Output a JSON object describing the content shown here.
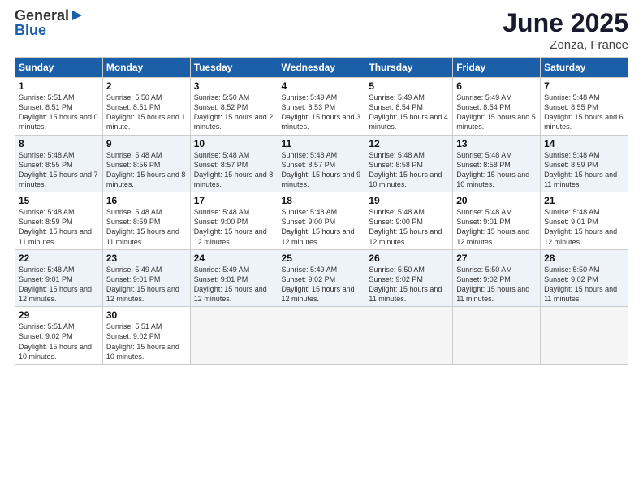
{
  "logo": {
    "text_general": "General",
    "text_blue": "Blue"
  },
  "title": "June 2025",
  "subtitle": "Zonza, France",
  "days_of_week": [
    "Sunday",
    "Monday",
    "Tuesday",
    "Wednesday",
    "Thursday",
    "Friday",
    "Saturday"
  ],
  "weeks": [
    [
      {
        "day": "1",
        "sunrise": "5:51 AM",
        "sunset": "8:51 PM",
        "daylight": "15 hours and 0 minutes."
      },
      {
        "day": "2",
        "sunrise": "5:50 AM",
        "sunset": "8:51 PM",
        "daylight": "15 hours and 1 minute."
      },
      {
        "day": "3",
        "sunrise": "5:50 AM",
        "sunset": "8:52 PM",
        "daylight": "15 hours and 2 minutes."
      },
      {
        "day": "4",
        "sunrise": "5:49 AM",
        "sunset": "8:53 PM",
        "daylight": "15 hours and 3 minutes."
      },
      {
        "day": "5",
        "sunrise": "5:49 AM",
        "sunset": "8:54 PM",
        "daylight": "15 hours and 4 minutes."
      },
      {
        "day": "6",
        "sunrise": "5:49 AM",
        "sunset": "8:54 PM",
        "daylight": "15 hours and 5 minutes."
      },
      {
        "day": "7",
        "sunrise": "5:48 AM",
        "sunset": "8:55 PM",
        "daylight": "15 hours and 6 minutes."
      }
    ],
    [
      {
        "day": "8",
        "sunrise": "5:48 AM",
        "sunset": "8:55 PM",
        "daylight": "15 hours and 7 minutes."
      },
      {
        "day": "9",
        "sunrise": "5:48 AM",
        "sunset": "8:56 PM",
        "daylight": "15 hours and 8 minutes."
      },
      {
        "day": "10",
        "sunrise": "5:48 AM",
        "sunset": "8:57 PM",
        "daylight": "15 hours and 8 minutes."
      },
      {
        "day": "11",
        "sunrise": "5:48 AM",
        "sunset": "8:57 PM",
        "daylight": "15 hours and 9 minutes."
      },
      {
        "day": "12",
        "sunrise": "5:48 AM",
        "sunset": "8:58 PM",
        "daylight": "15 hours and 10 minutes."
      },
      {
        "day": "13",
        "sunrise": "5:48 AM",
        "sunset": "8:58 PM",
        "daylight": "15 hours and 10 minutes."
      },
      {
        "day": "14",
        "sunrise": "5:48 AM",
        "sunset": "8:59 PM",
        "daylight": "15 hours and 11 minutes."
      }
    ],
    [
      {
        "day": "15",
        "sunrise": "5:48 AM",
        "sunset": "8:59 PM",
        "daylight": "15 hours and 11 minutes."
      },
      {
        "day": "16",
        "sunrise": "5:48 AM",
        "sunset": "8:59 PM",
        "daylight": "15 hours and 11 minutes."
      },
      {
        "day": "17",
        "sunrise": "5:48 AM",
        "sunset": "9:00 PM",
        "daylight": "15 hours and 12 minutes."
      },
      {
        "day": "18",
        "sunrise": "5:48 AM",
        "sunset": "9:00 PM",
        "daylight": "15 hours and 12 minutes."
      },
      {
        "day": "19",
        "sunrise": "5:48 AM",
        "sunset": "9:00 PM",
        "daylight": "15 hours and 12 minutes."
      },
      {
        "day": "20",
        "sunrise": "5:48 AM",
        "sunset": "9:01 PM",
        "daylight": "15 hours and 12 minutes."
      },
      {
        "day": "21",
        "sunrise": "5:48 AM",
        "sunset": "9:01 PM",
        "daylight": "15 hours and 12 minutes."
      }
    ],
    [
      {
        "day": "22",
        "sunrise": "5:48 AM",
        "sunset": "9:01 PM",
        "daylight": "15 hours and 12 minutes."
      },
      {
        "day": "23",
        "sunrise": "5:49 AM",
        "sunset": "9:01 PM",
        "daylight": "15 hours and 12 minutes."
      },
      {
        "day": "24",
        "sunrise": "5:49 AM",
        "sunset": "9:01 PM",
        "daylight": "15 hours and 12 minutes."
      },
      {
        "day": "25",
        "sunrise": "5:49 AM",
        "sunset": "9:02 PM",
        "daylight": "15 hours and 12 minutes."
      },
      {
        "day": "26",
        "sunrise": "5:50 AM",
        "sunset": "9:02 PM",
        "daylight": "15 hours and 11 minutes."
      },
      {
        "day": "27",
        "sunrise": "5:50 AM",
        "sunset": "9:02 PM",
        "daylight": "15 hours and 11 minutes."
      },
      {
        "day": "28",
        "sunrise": "5:50 AM",
        "sunset": "9:02 PM",
        "daylight": "15 hours and 11 minutes."
      }
    ],
    [
      {
        "day": "29",
        "sunrise": "5:51 AM",
        "sunset": "9:02 PM",
        "daylight": "15 hours and 10 minutes."
      },
      {
        "day": "30",
        "sunrise": "5:51 AM",
        "sunset": "9:02 PM",
        "daylight": "15 hours and 10 minutes."
      },
      null,
      null,
      null,
      null,
      null
    ]
  ]
}
